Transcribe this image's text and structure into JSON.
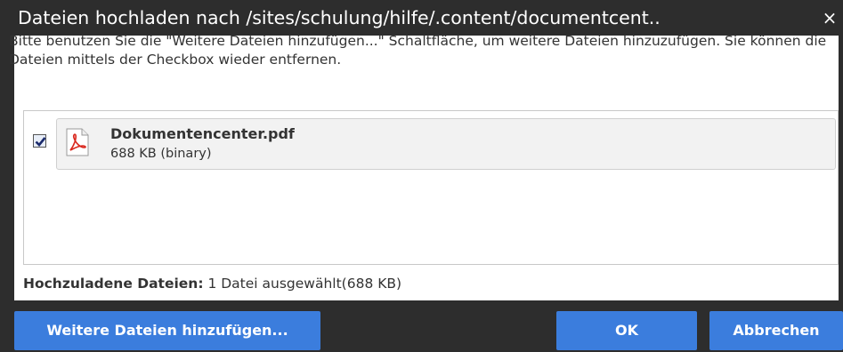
{
  "dialog": {
    "title": "Dateien hochladen nach /sites/schulung/hilfe/.content/documentcent..",
    "close_label": "×"
  },
  "instructions": "Bitte benutzen Sie die \"Weitere Dateien hinzufügen...\" Schaltfläche, um weitere Dateien hinzuzufügen. Sie können die Dateien mittels der Checkbox wieder entfernen.",
  "files": [
    {
      "name": "Dokumentencenter.pdf",
      "size": "688 KB (binary)",
      "checked": true,
      "icon": "pdf-icon"
    }
  ],
  "summary": {
    "label": "Hochzuladene Dateien:",
    "value": " 1 Datei ausgewählt(688 KB)"
  },
  "buttons": {
    "more_label": "Weitere Dateien hinzufügen...",
    "ok_label": "OK",
    "cancel_label": "Abbrechen"
  },
  "colors": {
    "accent": "#3b7ddd",
    "titlebar": "#2d2d2d",
    "pdf_red": "#d9261c"
  }
}
